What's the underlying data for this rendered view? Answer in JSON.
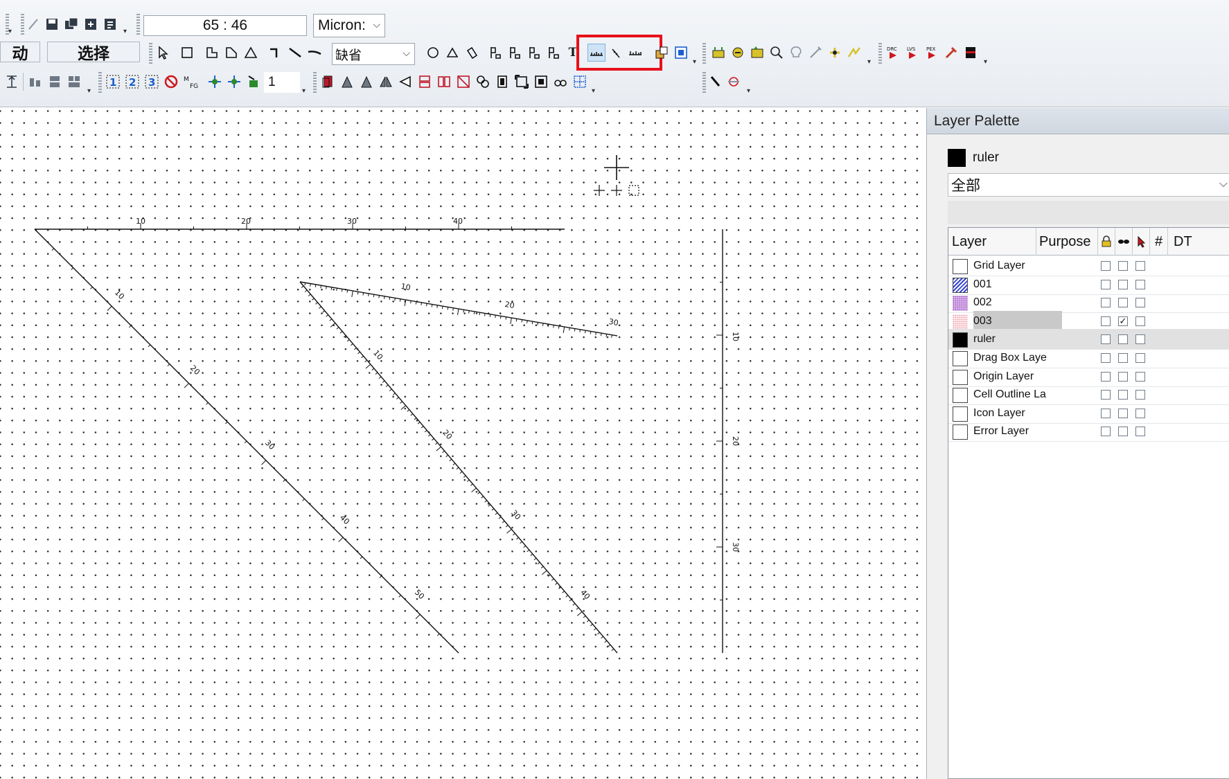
{
  "toolbar": {
    "coord_readout": "65 : 46",
    "unit_select": "Micron:",
    "mode_label_left": "动",
    "mode_label_select": "选择",
    "layer_purpose_select": "缺省",
    "step_value": "1",
    "accent_highlight": "#e8101a"
  },
  "canvas": {
    "horizontal_ruler": [
      "10",
      "20",
      "30",
      "40"
    ],
    "vertical_ruler": [
      "10",
      "20",
      "30"
    ],
    "diagonal_ruler_long": [
      "10",
      "20",
      "30",
      "40",
      "50"
    ],
    "diagonal_ruler_mid": [
      "10",
      "20",
      "30",
      "40"
    ],
    "diagonal_ruler_short": [
      "10",
      "20",
      "30"
    ]
  },
  "palette": {
    "title": "Layer Palette",
    "current_layer": "ruler",
    "filter": "全部",
    "columns": [
      "Layer",
      "Purpose",
      "#",
      "DT"
    ],
    "layers": [
      {
        "name": "Grid Layer",
        "fill": "none",
        "visible": false
      },
      {
        "name": "001",
        "fill": "blue-hatch",
        "visible": false
      },
      {
        "name": "002",
        "fill": "purple-dots",
        "visible": false
      },
      {
        "name": "003",
        "fill": "pink-dots",
        "visible": true
      },
      {
        "name": "ruler",
        "fill": "black",
        "visible": false
      },
      {
        "name": "Drag Box Laye",
        "fill": "none",
        "visible": false
      },
      {
        "name": "Origin Layer",
        "fill": "none",
        "visible": false
      },
      {
        "name": "Cell Outline La",
        "fill": "none",
        "visible": false
      },
      {
        "name": "Icon Layer",
        "fill": "none",
        "visible": false
      },
      {
        "name": "Error Layer",
        "fill": "none",
        "visible": false
      }
    ]
  }
}
